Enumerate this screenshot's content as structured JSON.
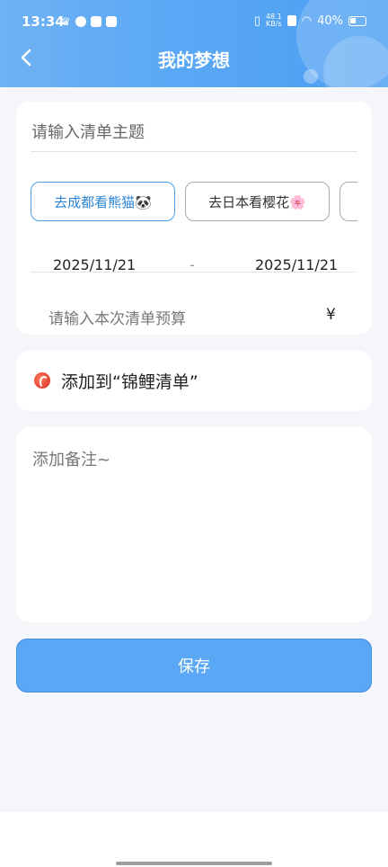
{
  "status_bar": {
    "time": "13:34",
    "net_speed": "48.1",
    "net_unit": "KB/s",
    "battery": "40%"
  },
  "header": {
    "title": "我的梦想",
    "back_icon": "chevron-left-icon"
  },
  "form": {
    "subject_placeholder": "请输入清单主题",
    "chips": [
      "去成都看熊猫🐼",
      "去日本看樱花🌸"
    ],
    "start_date": "2025/11/21",
    "separator": "-",
    "end_date": "2025/11/21",
    "budget_placeholder": "请输入本次清单预算",
    "currency_symbol": "¥"
  },
  "koi_list": {
    "icon": "koi-icon",
    "label": "添加到“锦鲤清单”"
  },
  "note": {
    "placeholder": "添加备注~"
  },
  "actions": {
    "save_label": "保存"
  },
  "colors": {
    "header_blue": "#5aa8f5",
    "active_chip": "#2b86d8",
    "page_bg": "#f4f6fa"
  }
}
